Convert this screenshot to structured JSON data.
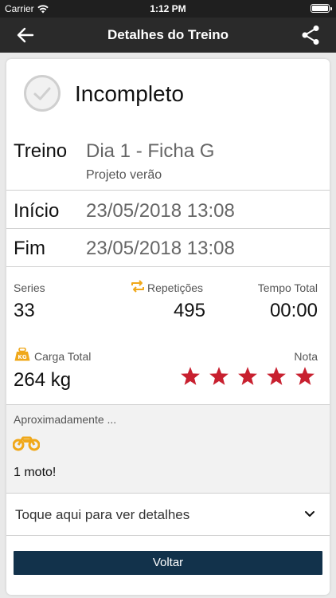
{
  "status_bar": {
    "carrier": "Carrier",
    "time": "1:12 PM"
  },
  "header": {
    "title": "Detalhes do Treino"
  },
  "workout": {
    "status": "Incompleto",
    "treino_label": "Treino",
    "treino_value": "Dia 1 - Ficha G",
    "treino_sub": "Projeto verão",
    "inicio_label": "Início",
    "inicio_value": "23/05/2018 13:08",
    "fim_label": "Fim",
    "fim_value": "23/05/2018 13:08"
  },
  "stats": {
    "series_label": "Series",
    "series_value": "33",
    "repeticoes_label": "Repetições",
    "repeticoes_value": "495",
    "tempo_label": "Tempo Total",
    "tempo_value": "00:00",
    "carga_label": "Carga Total",
    "carga_value": "264 kg",
    "nota_label": "Nota",
    "nota_stars": 5,
    "kg_badge": "KG"
  },
  "approx": {
    "label": "Aproximadamente ...",
    "result": "1 moto!"
  },
  "details": {
    "label": "Toque aqui para ver detalhes"
  },
  "actions": {
    "voltar": "Voltar"
  },
  "colors": {
    "header": "#2a2a2a",
    "star": "#c8202f",
    "accent_icon": "#f0a81a",
    "button": "#12324b"
  }
}
